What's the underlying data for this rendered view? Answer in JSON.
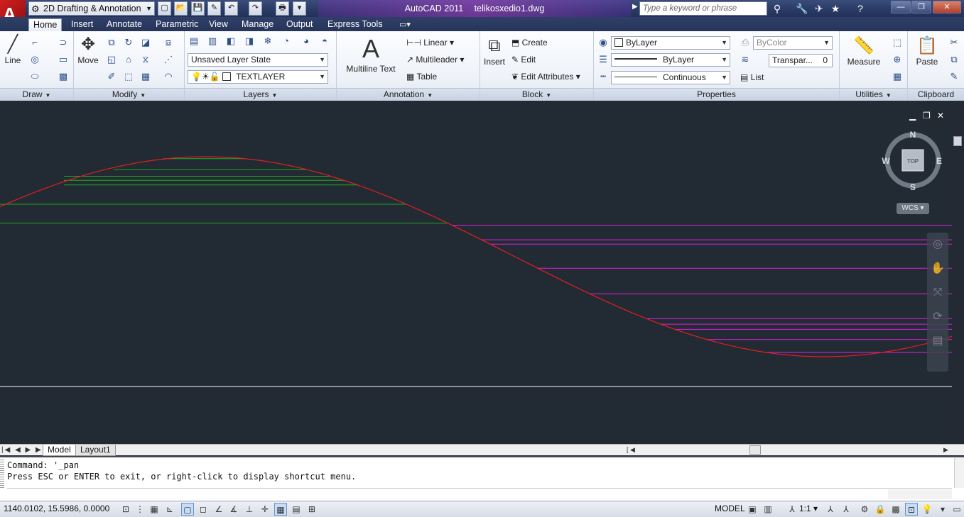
{
  "app": {
    "logo": "A",
    "title": "AutoCAD 2011",
    "document": "telikosxedio1.dwg",
    "workspace": "2D Drafting & Annotation",
    "search_placeholder": "Type a keyword or phrase"
  },
  "tabs": [
    "Home",
    "Insert",
    "Annotate",
    "Parametric",
    "View",
    "Manage",
    "Output",
    "Express Tools"
  ],
  "ribbon": {
    "draw": {
      "title": "Draw",
      "line_label": "Line"
    },
    "modify": {
      "title": "Modify",
      "move_label": "Move"
    },
    "layers": {
      "title": "Layers",
      "layer_state": "Unsaved Layer State",
      "current_layer": "TEXTLAYER"
    },
    "annotation": {
      "title": "Annotation",
      "mtext_label": "Multiline Text",
      "linear": "Linear",
      "multileader": "Multileader",
      "table": "Table"
    },
    "block": {
      "title": "Block",
      "insert": "Insert",
      "create": "Create",
      "edit": "Edit",
      "edit_attributes": "Edit Attributes"
    },
    "properties": {
      "title": "Properties",
      "color": "ByLayer",
      "lineweight": "ByLayer",
      "linetype": "Continuous",
      "plot_style": "ByColor",
      "transparency": "Transpar...",
      "transparency_value": "0",
      "list": "List"
    },
    "utilities": {
      "title": "Utilities",
      "measure": "Measure"
    },
    "clipboard": {
      "title": "Clipboard",
      "paste": "Paste"
    }
  },
  "viewcube": {
    "north": "N",
    "south": "S",
    "east": "E",
    "west": "W",
    "face": "TOP",
    "wcs": "WCS"
  },
  "layout_tabs": [
    "Model",
    "Layout1"
  ],
  "command": {
    "line1": "Command: '_pan",
    "line2": "Press ESC or ENTER to exit, or right-click to display shortcut menu."
  },
  "status": {
    "coords": "1140.0102, 15.5986, 0.0000",
    "space": "MODEL",
    "scale": "1:1"
  },
  "colors": {
    "curve": "#e21f1f",
    "green_lines": "#1faa1f",
    "magenta_lines": "#e020e0",
    "background": "#222a33"
  }
}
